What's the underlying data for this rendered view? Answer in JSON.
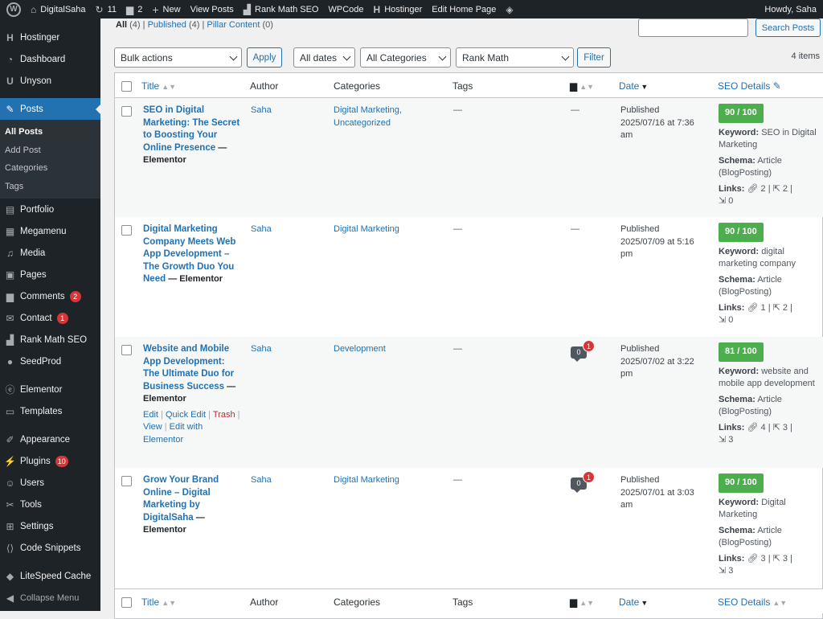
{
  "adminbar": {
    "site_name": "DigitalSaha",
    "updates_count": "11",
    "comments_count": "2",
    "new_label": "New",
    "view_posts": "View Posts",
    "rank_math": "Rank Math SEO",
    "wpcode": "WPCode",
    "hostinger": "Hostinger",
    "edit_home": "Edit Home Page",
    "howdy": "Howdy, Saha"
  },
  "sidebar": {
    "items": [
      {
        "label": "Hostinger",
        "icon": "hostinger-icon"
      },
      {
        "label": "Dashboard",
        "icon": "dashboard-icon"
      },
      {
        "label": "Unyson",
        "icon": "unyson-icon"
      },
      {
        "label": "Posts",
        "icon": "pin-icon"
      },
      {
        "label": "Portfolio",
        "icon": "portfolio-icon"
      },
      {
        "label": "Megamenu",
        "icon": "megamenu-icon"
      },
      {
        "label": "Media",
        "icon": "media-icon"
      },
      {
        "label": "Pages",
        "icon": "pages-icon"
      },
      {
        "label": "Comments",
        "icon": "comments-icon",
        "badge": "2"
      },
      {
        "label": "Contact",
        "icon": "mail-icon",
        "badge": "1"
      },
      {
        "label": "Rank Math SEO",
        "icon": "rank-math-icon"
      },
      {
        "label": "SeedProd",
        "icon": "seedprod-icon"
      },
      {
        "label": "Elementor",
        "icon": "elementor-icon"
      },
      {
        "label": "Templates",
        "icon": "folder-icon"
      },
      {
        "label": "Appearance",
        "icon": "brush-icon"
      },
      {
        "label": "Plugins",
        "icon": "plugin-icon",
        "badge": "10"
      },
      {
        "label": "Users",
        "icon": "users-icon"
      },
      {
        "label": "Tools",
        "icon": "wrench-icon"
      },
      {
        "label": "Settings",
        "icon": "settings-icon"
      },
      {
        "label": "Code Snippets",
        "icon": "code-icon"
      },
      {
        "label": "LiteSpeed Cache",
        "icon": "litespeed-icon"
      },
      {
        "label": "Collapse Menu",
        "icon": "collapse-icon"
      }
    ],
    "posts_sub": [
      "All Posts",
      "Add Post",
      "Categories",
      "Tags"
    ]
  },
  "filters": {
    "all": "All",
    "all_count": "(4)",
    "published": "Published",
    "published_count": "(4)",
    "pillar": "Pillar Content",
    "pillar_count": "(0)",
    "search_button": "Search Posts",
    "bulk_actions": "Bulk actions",
    "apply": "Apply",
    "all_dates": "All dates",
    "all_categories": "All Categories",
    "rank_math": "Rank Math",
    "filter": "Filter",
    "item_count": "4 items"
  },
  "columns": {
    "title": "Title",
    "author": "Author",
    "categories": "Categories",
    "tags": "Tags",
    "date": "Date",
    "seo": "SEO Details"
  },
  "posts": [
    {
      "title": "SEO in Digital Marketing: The Secret to Boosting Your Online Presence",
      "state": "— Elementor",
      "author": "Saha",
      "categories": "Digital Marketing, Uncategorized",
      "tags": "—",
      "comments": "—",
      "status": "Published",
      "date": "2025/07/16 at 7:36 am",
      "score": "90 / 100",
      "keyword": "SEO in Digital Marketing",
      "schema": "Article (BlogPosting)",
      "links_internal": "2",
      "links_external": "2",
      "links_incoming": "0"
    },
    {
      "title": "Digital Marketing Company Meets Web App Development – The Growth Duo You Need",
      "state": "— Elementor",
      "author": "Saha",
      "categories": "Digital Marketing",
      "tags": "—",
      "comments": "—",
      "status": "Published",
      "date": "2025/07/09 at 5:16 pm",
      "score": "90 / 100",
      "keyword": "digital marketing company",
      "schema": "Article (BlogPosting)",
      "links_internal": "1",
      "links_external": "2",
      "links_incoming": "0"
    },
    {
      "title": "Website and Mobile App Development: The Ultimate Duo for Business Success",
      "state": "— Elementor",
      "author": "Saha",
      "categories": "Development",
      "tags": "—",
      "comments_approved": "0",
      "comments_pending": "1",
      "status": "Published",
      "date": "2025/07/02 at 3:22 pm",
      "score": "81 / 100",
      "keyword": "website and mobile app development",
      "schema": "Article (BlogPosting)",
      "links_internal": "4",
      "links_external": "3",
      "links_incoming": "3",
      "actions": {
        "edit": "Edit",
        "quick_edit": "Quick Edit",
        "trash": "Trash",
        "view": "View",
        "edit_elementor": "Edit with Elementor"
      }
    },
    {
      "title": "Grow Your Brand Online – Digital Marketing by DigitalSaha",
      "state": "— Elementor",
      "author": "Saha",
      "categories": "Digital Marketing",
      "tags": "—",
      "comments_approved": "0",
      "comments_pending": "1",
      "status": "Published",
      "date": "2025/07/01 at 3:03 am",
      "score": "90 / 100",
      "keyword": "Digital Marketing",
      "schema": "Article (BlogPosting)",
      "links_internal": "3",
      "links_external": "3",
      "links_incoming": "3"
    }
  ],
  "labels": {
    "keyword": "Keyword:",
    "schema": "Schema:",
    "links": "Links:"
  },
  "colors": {
    "admin_dark": "#1d2327",
    "active_blue": "#2271b1",
    "score_green": "#4cae4c",
    "badge_red": "#d63638"
  }
}
